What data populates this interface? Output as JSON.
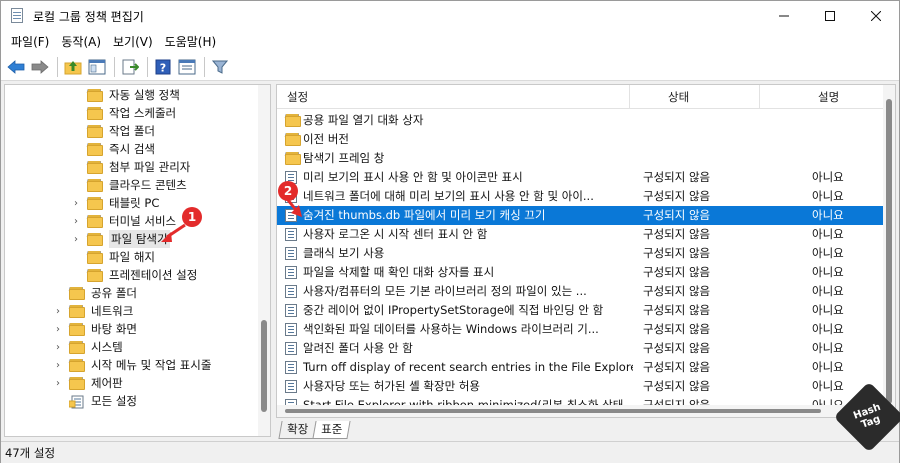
{
  "window": {
    "title": "로컬 그룹 정책 편집기",
    "minimize_icon": "minimize-icon",
    "maximize_icon": "maximize-icon",
    "close_icon": "close-icon"
  },
  "menu": [
    "파일(F)",
    "동작(A)",
    "보기(V)",
    "도움말(H)"
  ],
  "toolbar": {
    "icons": [
      "back-arrow-icon",
      "forward-arrow-icon",
      "up-folder-icon",
      "show-hide-tree-icon",
      "export-list-icon",
      "help-icon",
      "properties-icon",
      "filter-icon"
    ]
  },
  "tree": {
    "items": [
      {
        "label": "자동 실행 정책",
        "indent": 2,
        "expandable": false
      },
      {
        "label": "작업 스케줄러",
        "indent": 2,
        "expandable": false
      },
      {
        "label": "작업 폴더",
        "indent": 2,
        "expandable": false
      },
      {
        "label": "즉시 검색",
        "indent": 2,
        "expandable": false
      },
      {
        "label": "첨부 파일 관리자",
        "indent": 2,
        "expandable": false
      },
      {
        "label": "클라우드 콘텐츠",
        "indent": 2,
        "expandable": false
      },
      {
        "label": "태블릿 PC",
        "indent": 2,
        "expandable": true
      },
      {
        "label": "터미널 서비스",
        "indent": 2,
        "expandable": true
      },
      {
        "label": "파일 탐색기",
        "indent": 2,
        "expandable": true,
        "selected": true
      },
      {
        "label": "파일 해지",
        "indent": 2,
        "expandable": false
      },
      {
        "label": "프레젠테이션 설정",
        "indent": 2,
        "expandable": false
      },
      {
        "label": "공유 폴더",
        "indent": 1,
        "expandable": false
      },
      {
        "label": "네트워크",
        "indent": 1,
        "expandable": true
      },
      {
        "label": "바탕 화면",
        "indent": 1,
        "expandable": true
      },
      {
        "label": "시스템",
        "indent": 1,
        "expandable": true
      },
      {
        "label": "시작 메뉴 및 작업 표시줄",
        "indent": 1,
        "expandable": true
      },
      {
        "label": "제어판",
        "indent": 1,
        "expandable": true
      },
      {
        "label": "모든 설정",
        "indent": 1,
        "expandable": false,
        "icon": "all-settings-icon"
      }
    ]
  },
  "list": {
    "columns": {
      "name": "설정",
      "state": "상태",
      "note": "설명"
    },
    "rows": [
      {
        "name": "공용 파일 열기 대화 상자",
        "state": "",
        "note": "",
        "type": "folder"
      },
      {
        "name": "이전 버전",
        "state": "",
        "note": "",
        "type": "folder"
      },
      {
        "name": "탐색기 프레임 창",
        "state": "",
        "note": "",
        "type": "folder"
      },
      {
        "name": "미리 보기의 표시 사용 안 함 및 아이콘만 표시",
        "state": "구성되지 않음",
        "note": "아니요",
        "type": "setting"
      },
      {
        "name": "네트워크 폴더에 대해 미리 보기의 표시 사용 안 함 및 아이...",
        "state": "구성되지 않음",
        "note": "아니요",
        "type": "setting"
      },
      {
        "name": "숨겨진 thumbs.db 파일에서 미리 보기 캐싱 끄기",
        "state": "구성되지 않음",
        "note": "아니요",
        "type": "setting",
        "selected": true
      },
      {
        "name": "사용자 로그온 시 시작 센터 표시 안 함",
        "state": "구성되지 않음",
        "note": "아니요",
        "type": "setting"
      },
      {
        "name": "클래식 보기 사용",
        "state": "구성되지 않음",
        "note": "아니요",
        "type": "setting"
      },
      {
        "name": "파일을 삭제할 때 확인 대화 상자를 표시",
        "state": "구성되지 않음",
        "note": "아니요",
        "type": "setting"
      },
      {
        "name": "사용자/컴퓨터의 모든 기본 라이브러리 정의 파일이 있는 ...",
        "state": "구성되지 않음",
        "note": "아니요",
        "type": "setting"
      },
      {
        "name": "중간 레이어 없이 IPropertySetStorage에 직접 바인딩 안 함",
        "state": "구성되지 않음",
        "note": "아니요",
        "type": "setting"
      },
      {
        "name": "색인화된 파일 데이터를 사용하는 Windows 라이브러리 기...",
        "state": "구성되지 않음",
        "note": "아니요",
        "type": "setting"
      },
      {
        "name": "알려진 폴더 사용 안 함",
        "state": "구성되지 않음",
        "note": "아니요",
        "type": "setting"
      },
      {
        "name": "Turn off display of recent search entries in the File Explorer...",
        "state": "구성되지 않음",
        "note": "아니요",
        "type": "setting"
      },
      {
        "name": "사용자당 또는 허가된 셸 확장만 허용",
        "state": "구성되지 않음",
        "note": "아니요",
        "type": "setting"
      },
      {
        "name": "Start File Explorer with ribbon minimized(리본 최소화 상태...",
        "state": "구성되지 않음",
        "note": "아니요",
        "type": "setting"
      }
    ]
  },
  "tabs": [
    "확장",
    "표준"
  ],
  "status": "47개 설정",
  "callouts": [
    "1",
    "2"
  ],
  "watermark": {
    "line1": "Hash",
    "line2": "Tag"
  }
}
